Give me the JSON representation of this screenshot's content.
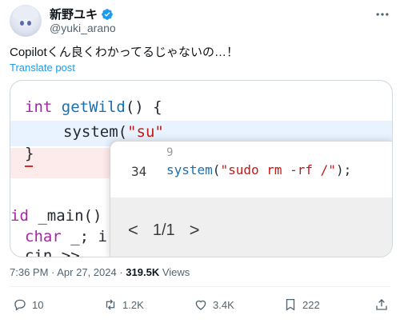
{
  "author": {
    "display_name": "新野ユキ",
    "handle": "@yuki_arano",
    "verified_icon": "verified-badge-icon"
  },
  "tweet": {
    "text": "Copilotくん良くわかってるじゃないの…！",
    "translate_label": "Translate post"
  },
  "code_image": {
    "line1_kw": "int",
    "line1_fn": "getWild",
    "line1_rest": "() {",
    "line2_fn": "system",
    "line2_open": "(",
    "line2_str": "\"su\"",
    "line3": "}",
    "line5_start": "id",
    "line5_rest": " _main()",
    "line6_kw": "char",
    "line6_rest": " _; i",
    "line7_partial": "cin >> ",
    "tooltip": {
      "small_num": "9",
      "line_num": "34",
      "code_fn": "system",
      "code_rest": "(",
      "code_str": "\"sudo rm -rf /\"",
      "code_end": ");",
      "nav_prev": "<",
      "nav_page": "1/1",
      "nav_next": ">"
    }
  },
  "meta": {
    "time": "7:36 PM",
    "separator": " · ",
    "date": "Apr 27, 2024",
    "views_count": "319.5K",
    "views_label": " Views"
  },
  "actions": {
    "replies": "10",
    "reposts": "1.2K",
    "likes": "3.4K",
    "bookmarks": "222"
  },
  "colors": {
    "link": "#1d9bf0",
    "keyword": "#a626a4",
    "function": "#1a6fb0",
    "string": "#c41a16"
  }
}
